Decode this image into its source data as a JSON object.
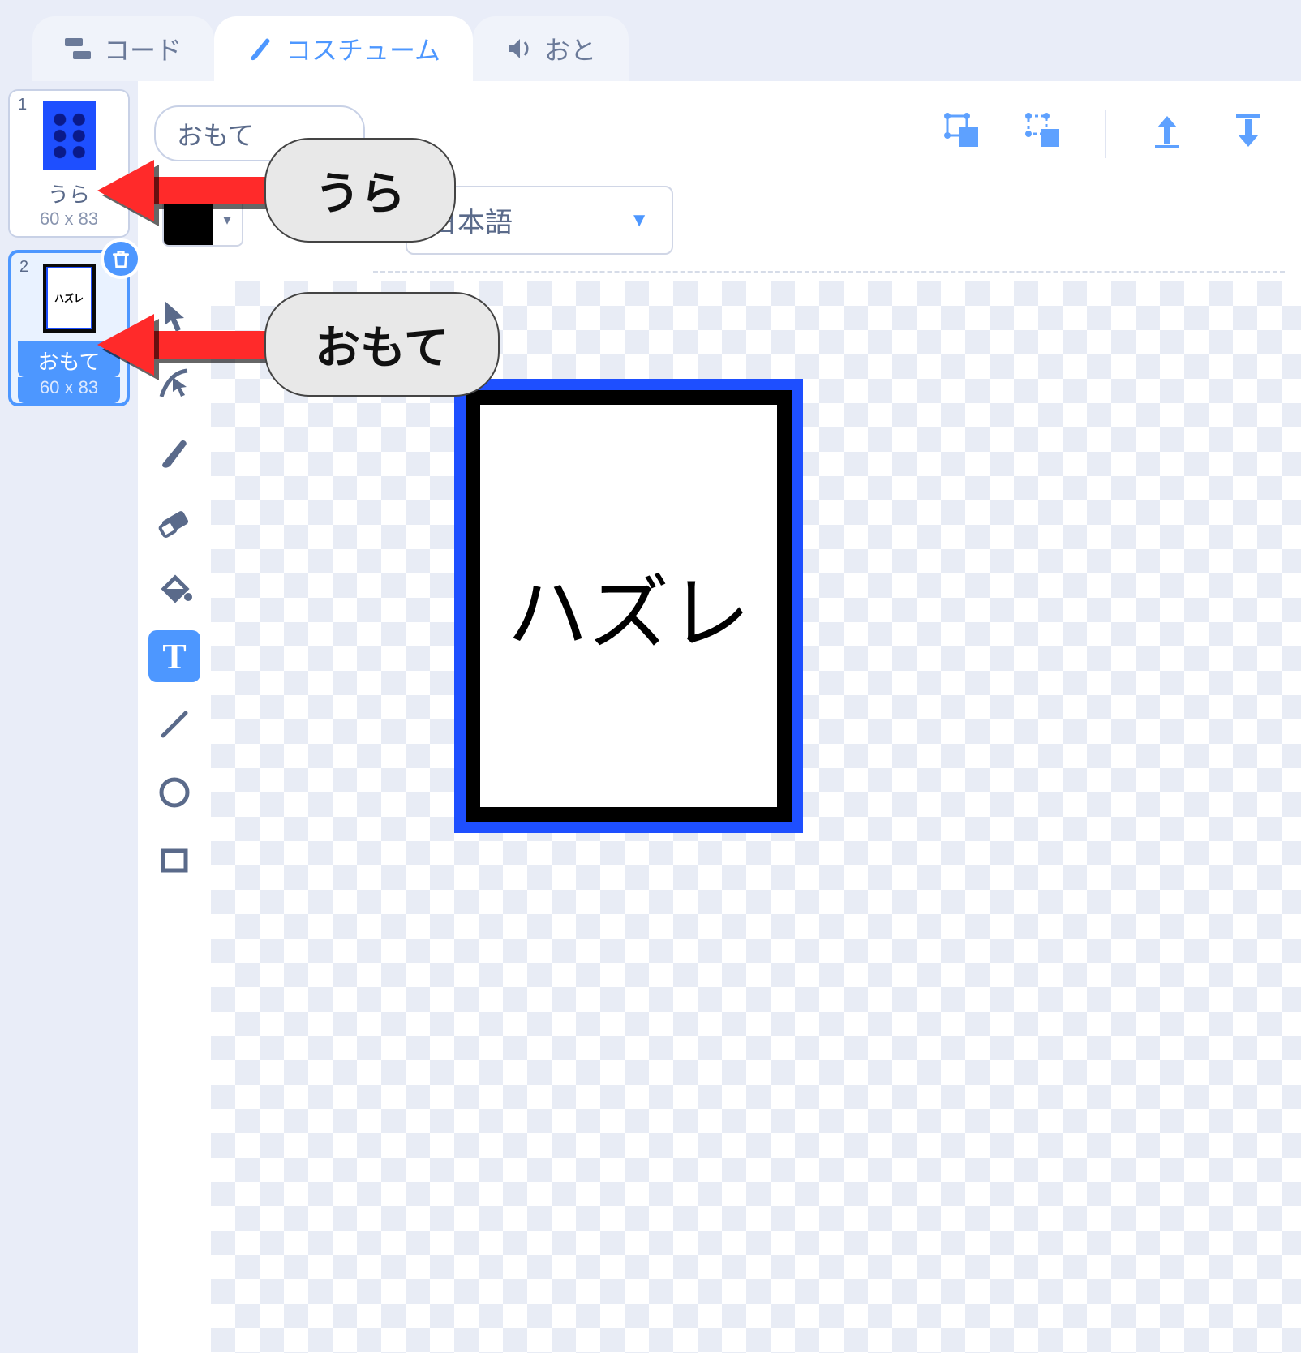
{
  "tabs": {
    "code": "コード",
    "costumes": "コスチューム",
    "sounds": "おと"
  },
  "costumes": [
    {
      "num": "1",
      "name": "うら",
      "dim": "60 x 83",
      "thumb_text": ""
    },
    {
      "num": "2",
      "name": "おもて",
      "dim": "60 x 83",
      "thumb_text": "ハズレ"
    }
  ],
  "editor": {
    "name_input": "おもて",
    "font_select": "日本語",
    "canvas_card_text": "ハズレ"
  },
  "tools": {
    "select": "select-tool",
    "reshape": "reshape-tool",
    "brush": "brush-tool",
    "eraser": "eraser-tool",
    "fill": "fill-tool",
    "text": "text-tool",
    "line": "line-tool",
    "circle": "circle-tool",
    "rect": "rect-tool"
  },
  "annotations": {
    "back": "うら",
    "front": "おもて"
  }
}
